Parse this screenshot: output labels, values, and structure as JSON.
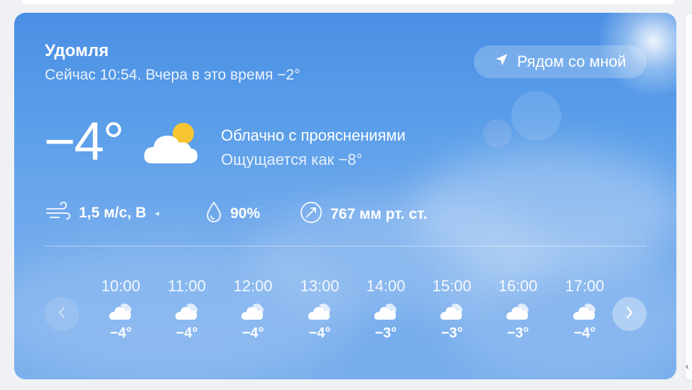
{
  "location": {
    "city": "Удомля",
    "now_text": "Сейчас 10:54. Вчера в это время −2°"
  },
  "near_me_button": {
    "label": "Рядом со мной",
    "icon": "location-arrow-icon"
  },
  "current": {
    "temperature": "−4°",
    "condition": "Облачно с прояснениями",
    "feels_like": "Ощущается как −8°",
    "icon": "partly-cloudy-icon"
  },
  "stats": {
    "wind": {
      "value": "1,5 м/с, В",
      "icon": "wind-icon"
    },
    "humidity": {
      "value": "90%",
      "icon": "humidity-drop-icon"
    },
    "pressure": {
      "value": "767 мм рт. ст.",
      "icon": "pressure-gauge-icon"
    }
  },
  "hourly": [
    {
      "time": "10:00",
      "temp": "−4°",
      "icon": "partly-cloudy-icon"
    },
    {
      "time": "11:00",
      "temp": "−4°",
      "icon": "partly-cloudy-icon"
    },
    {
      "time": "12:00",
      "temp": "−4°",
      "icon": "partly-cloudy-icon"
    },
    {
      "time": "13:00",
      "temp": "−4°",
      "icon": "partly-cloudy-icon"
    },
    {
      "time": "14:00",
      "temp": "−3°",
      "icon": "partly-cloudy-icon"
    },
    {
      "time": "15:00",
      "temp": "−3°",
      "icon": "partly-cloudy-icon"
    },
    {
      "time": "16:00",
      "temp": "−3°",
      "icon": "partly-cloudy-icon"
    },
    {
      "time": "17:00",
      "temp": "−4°",
      "icon": "partly-cloudy-icon"
    }
  ],
  "colors": {
    "card_top": "#4a8fe4",
    "card_bottom": "#78aeed",
    "sun": "#f7c531"
  }
}
